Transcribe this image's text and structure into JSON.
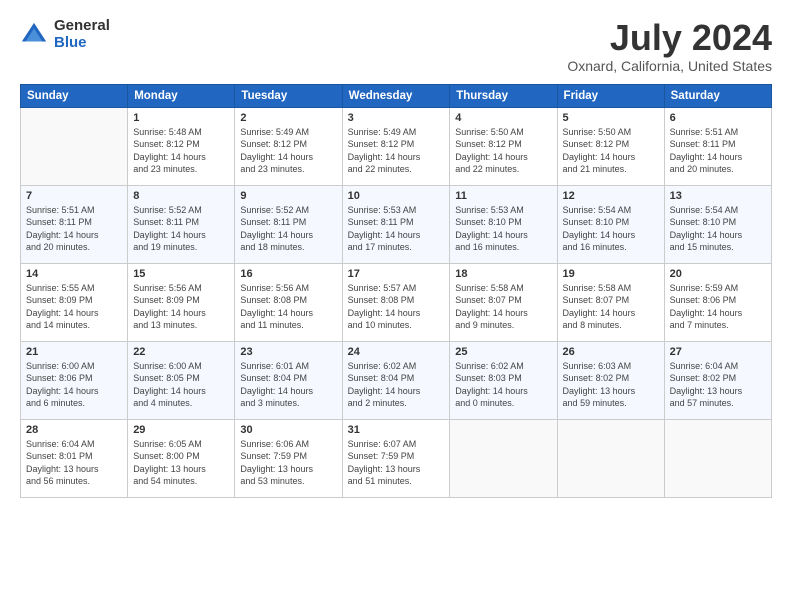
{
  "logo": {
    "general": "General",
    "blue": "Blue"
  },
  "title": "July 2024",
  "subtitle": "Oxnard, California, United States",
  "days_of_week": [
    "Sunday",
    "Monday",
    "Tuesday",
    "Wednesday",
    "Thursday",
    "Friday",
    "Saturday"
  ],
  "weeks": [
    [
      {
        "day": "",
        "info": ""
      },
      {
        "day": "1",
        "info": "Sunrise: 5:48 AM\nSunset: 8:12 PM\nDaylight: 14 hours\nand 23 minutes."
      },
      {
        "day": "2",
        "info": "Sunrise: 5:49 AM\nSunset: 8:12 PM\nDaylight: 14 hours\nand 23 minutes."
      },
      {
        "day": "3",
        "info": "Sunrise: 5:49 AM\nSunset: 8:12 PM\nDaylight: 14 hours\nand 22 minutes."
      },
      {
        "day": "4",
        "info": "Sunrise: 5:50 AM\nSunset: 8:12 PM\nDaylight: 14 hours\nand 22 minutes."
      },
      {
        "day": "5",
        "info": "Sunrise: 5:50 AM\nSunset: 8:12 PM\nDaylight: 14 hours\nand 21 minutes."
      },
      {
        "day": "6",
        "info": "Sunrise: 5:51 AM\nSunset: 8:11 PM\nDaylight: 14 hours\nand 20 minutes."
      }
    ],
    [
      {
        "day": "7",
        "info": "Sunrise: 5:51 AM\nSunset: 8:11 PM\nDaylight: 14 hours\nand 20 minutes."
      },
      {
        "day": "8",
        "info": "Sunrise: 5:52 AM\nSunset: 8:11 PM\nDaylight: 14 hours\nand 19 minutes."
      },
      {
        "day": "9",
        "info": "Sunrise: 5:52 AM\nSunset: 8:11 PM\nDaylight: 14 hours\nand 18 minutes."
      },
      {
        "day": "10",
        "info": "Sunrise: 5:53 AM\nSunset: 8:11 PM\nDaylight: 14 hours\nand 17 minutes."
      },
      {
        "day": "11",
        "info": "Sunrise: 5:53 AM\nSunset: 8:10 PM\nDaylight: 14 hours\nand 16 minutes."
      },
      {
        "day": "12",
        "info": "Sunrise: 5:54 AM\nSunset: 8:10 PM\nDaylight: 14 hours\nand 16 minutes."
      },
      {
        "day": "13",
        "info": "Sunrise: 5:54 AM\nSunset: 8:10 PM\nDaylight: 14 hours\nand 15 minutes."
      }
    ],
    [
      {
        "day": "14",
        "info": "Sunrise: 5:55 AM\nSunset: 8:09 PM\nDaylight: 14 hours\nand 14 minutes."
      },
      {
        "day": "15",
        "info": "Sunrise: 5:56 AM\nSunset: 8:09 PM\nDaylight: 14 hours\nand 13 minutes."
      },
      {
        "day": "16",
        "info": "Sunrise: 5:56 AM\nSunset: 8:08 PM\nDaylight: 14 hours\nand 11 minutes."
      },
      {
        "day": "17",
        "info": "Sunrise: 5:57 AM\nSunset: 8:08 PM\nDaylight: 14 hours\nand 10 minutes."
      },
      {
        "day": "18",
        "info": "Sunrise: 5:58 AM\nSunset: 8:07 PM\nDaylight: 14 hours\nand 9 minutes."
      },
      {
        "day": "19",
        "info": "Sunrise: 5:58 AM\nSunset: 8:07 PM\nDaylight: 14 hours\nand 8 minutes."
      },
      {
        "day": "20",
        "info": "Sunrise: 5:59 AM\nSunset: 8:06 PM\nDaylight: 14 hours\nand 7 minutes."
      }
    ],
    [
      {
        "day": "21",
        "info": "Sunrise: 6:00 AM\nSunset: 8:06 PM\nDaylight: 14 hours\nand 6 minutes."
      },
      {
        "day": "22",
        "info": "Sunrise: 6:00 AM\nSunset: 8:05 PM\nDaylight: 14 hours\nand 4 minutes."
      },
      {
        "day": "23",
        "info": "Sunrise: 6:01 AM\nSunset: 8:04 PM\nDaylight: 14 hours\nand 3 minutes."
      },
      {
        "day": "24",
        "info": "Sunrise: 6:02 AM\nSunset: 8:04 PM\nDaylight: 14 hours\nand 2 minutes."
      },
      {
        "day": "25",
        "info": "Sunrise: 6:02 AM\nSunset: 8:03 PM\nDaylight: 14 hours\nand 0 minutes."
      },
      {
        "day": "26",
        "info": "Sunrise: 6:03 AM\nSunset: 8:02 PM\nDaylight: 13 hours\nand 59 minutes."
      },
      {
        "day": "27",
        "info": "Sunrise: 6:04 AM\nSunset: 8:02 PM\nDaylight: 13 hours\nand 57 minutes."
      }
    ],
    [
      {
        "day": "28",
        "info": "Sunrise: 6:04 AM\nSunset: 8:01 PM\nDaylight: 13 hours\nand 56 minutes."
      },
      {
        "day": "29",
        "info": "Sunrise: 6:05 AM\nSunset: 8:00 PM\nDaylight: 13 hours\nand 54 minutes."
      },
      {
        "day": "30",
        "info": "Sunrise: 6:06 AM\nSunset: 7:59 PM\nDaylight: 13 hours\nand 53 minutes."
      },
      {
        "day": "31",
        "info": "Sunrise: 6:07 AM\nSunset: 7:59 PM\nDaylight: 13 hours\nand 51 minutes."
      },
      {
        "day": "",
        "info": ""
      },
      {
        "day": "",
        "info": ""
      },
      {
        "day": "",
        "info": ""
      }
    ]
  ]
}
